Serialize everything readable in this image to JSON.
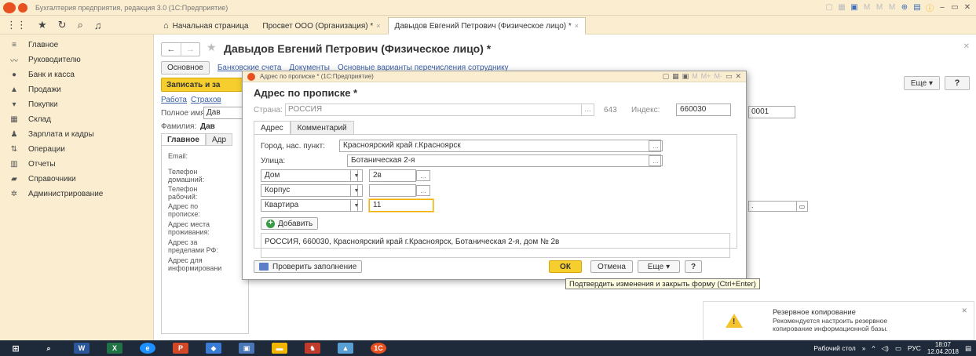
{
  "window": {
    "title": "Бухгалтерия предприятия, редакция 3.0 (1С:Предприятие)"
  },
  "tabs": [
    {
      "label": "Начальная страница"
    },
    {
      "label": "Просвет ООО (Организация) *",
      "close": "×"
    },
    {
      "label": "Давыдов Евгений Петрович (Физическое лицо) *",
      "close": "×"
    }
  ],
  "sidebar": {
    "items": [
      {
        "label": "Главное",
        "icon": "menu-icon"
      },
      {
        "label": "Руководителю",
        "icon": "chart-line-icon"
      },
      {
        "label": "Банк и касса",
        "icon": "bank-icon"
      },
      {
        "label": "Продажи",
        "icon": "sales-icon"
      },
      {
        "label": "Покупки",
        "icon": "cart-icon"
      },
      {
        "label": "Склад",
        "icon": "warehouse-icon"
      },
      {
        "label": "Зарплата и кадры",
        "icon": "person-icon"
      },
      {
        "label": "Операции",
        "icon": "operations-icon"
      },
      {
        "label": "Отчеты",
        "icon": "bar-chart-icon"
      },
      {
        "label": "Справочники",
        "icon": "book-icon"
      },
      {
        "label": "Администрирование",
        "icon": "gear-icon"
      }
    ]
  },
  "form": {
    "title": "Давыдов Евгений Петрович (Физическое лицо) *",
    "nav": {
      "main": "Основное",
      "bank": "Банковские счета",
      "docs": "Документы",
      "payments": "Основные варианты перечисления сотруднику"
    },
    "save_label": "Записать и за",
    "more_label": "Еще ▾",
    "help_label": "?",
    "links": [
      "Работа",
      "Страхов"
    ],
    "fullname_label": "Полное имя:",
    "fullname_value": "Дав",
    "surname_label": "Фамилия:",
    "surname_value": "Дав",
    "inn_value": "0001",
    "inner_tabs": [
      "Главное",
      "Адр"
    ],
    "contacts": [
      "Email:",
      "Телефон домашний:",
      "Телефон рабочий:",
      "Адрес по прописке:",
      "Адрес места проживания:",
      "Адрес за пределами РФ:",
      "Адрес для информировани"
    ]
  },
  "modal": {
    "caption": "Адрес по прописке * (1С:Предприятие)",
    "heading": "Адрес по прописке *",
    "country_label": "Страна:",
    "country_value": "РОССИЯ",
    "country_code": "643",
    "index_label": "Индекс:",
    "index_value": "660030",
    "tabs": [
      "Адрес",
      "Комментарий"
    ],
    "city_label": "Город, нас. пункт:",
    "city_value": "Красноярский край г.Красноярск",
    "street_label": "Улица:",
    "street_value": "Ботаническая 2-я",
    "house_type": "Дом",
    "house_value": "2в",
    "building_type": "Корпус",
    "building_value": "",
    "apartment_type": "Квартира",
    "apartment_value": "11",
    "add_label": "Добавить",
    "result": "РОССИЯ, 660030, Красноярский край г.Красноярск, Ботаническая 2-я, дом № 2в",
    "check_label": "Проверить заполнение",
    "ok_label": "ОК",
    "cancel_label": "Отмена",
    "more_label": "Еще",
    "help_label": "?"
  },
  "tooltip": "Подтвердить изменения и закрыть форму (Ctrl+Enter)",
  "notification": {
    "title": "Резервное копирование",
    "text": "Рекомендуется настроить резервное копирование информационной базы."
  },
  "taskbar": {
    "desktop": "Рабочий стол",
    "lang": "РУС",
    "time": "18:07",
    "date": "12.04.2018"
  }
}
